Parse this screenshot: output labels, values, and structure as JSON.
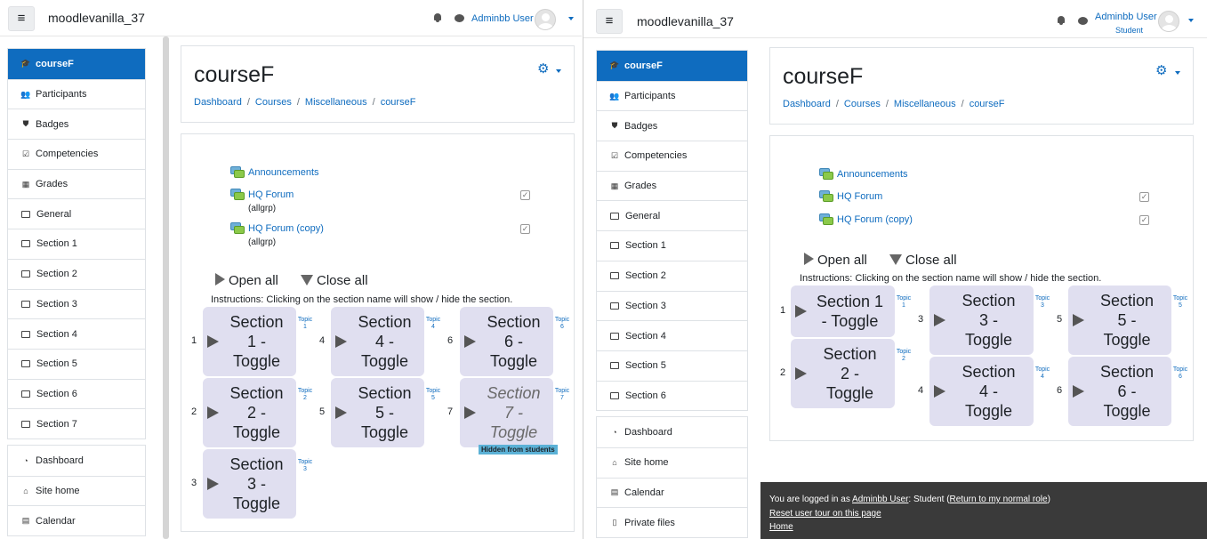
{
  "site_name": "moodlevanilla_37",
  "course_title": "courseF",
  "admin_window": {
    "user_name": "Adminbb User",
    "nav_main": [
      {
        "label": "courseF",
        "icon": "graduation-cap-icon",
        "active": true
      },
      {
        "label": "Participants",
        "icon": "users-icon"
      },
      {
        "label": "Badges",
        "icon": "shield-icon"
      },
      {
        "label": "Competencies",
        "icon": "check-square-icon"
      },
      {
        "label": "Grades",
        "icon": "table-icon"
      },
      {
        "label": "General",
        "icon": "folder-icon"
      },
      {
        "label": "Section 1",
        "icon": "folder-icon"
      },
      {
        "label": "Section 2",
        "icon": "folder-icon"
      },
      {
        "label": "Section 3",
        "icon": "folder-icon"
      },
      {
        "label": "Section 4",
        "icon": "folder-icon"
      },
      {
        "label": "Section 5",
        "icon": "folder-icon"
      },
      {
        "label": "Section 6",
        "icon": "folder-icon"
      },
      {
        "label": "Section 7",
        "icon": "folder-icon"
      }
    ],
    "nav_secondary": [
      {
        "label": "Dashboard",
        "icon": "tachometer-icon"
      },
      {
        "label": "Site home",
        "icon": "home-icon"
      },
      {
        "label": "Calendar",
        "icon": "calendar-icon"
      }
    ],
    "activities": [
      {
        "name": "Announcements",
        "note": "",
        "completion": false
      },
      {
        "name": "HQ Forum",
        "note": "(allgrp)",
        "completion": true
      },
      {
        "name": "HQ Forum (copy)",
        "note": "(allgrp)",
        "completion": true
      }
    ],
    "tiles": [
      {
        "number": "1",
        "lines": [
          "Section",
          "1 -",
          "Toggle"
        ],
        "topic": [
          "Topic",
          "1"
        ],
        "hidden": false
      },
      {
        "number": "2",
        "lines": [
          "Section",
          "2 -",
          "Toggle"
        ],
        "topic": [
          "Topic",
          "2"
        ],
        "hidden": false
      },
      {
        "number": "3",
        "lines": [
          "Section",
          "3 -",
          "Toggle"
        ],
        "topic": [
          "Topic",
          "3"
        ],
        "hidden": false
      },
      {
        "number": "4",
        "lines": [
          "Section",
          "4 -",
          "Toggle"
        ],
        "topic": [
          "Topic",
          "4"
        ],
        "hidden": false
      },
      {
        "number": "5",
        "lines": [
          "Section",
          "5 -",
          "Toggle"
        ],
        "topic": [
          "Topic",
          "5"
        ],
        "hidden": false
      },
      {
        "number": "6",
        "lines": [
          "Section",
          "6 -",
          "Toggle"
        ],
        "topic": [
          "Topic",
          "6"
        ],
        "hidden": false
      },
      {
        "number": "7",
        "lines": [
          "Section",
          "7 -",
          "Toggle"
        ],
        "topic": [
          "Topic",
          "7"
        ],
        "hidden": true
      }
    ]
  },
  "student_window": {
    "user_name": "Adminbb User",
    "role": "Student",
    "nav_main": [
      {
        "label": "courseF",
        "icon": "graduation-cap-icon",
        "active": true
      },
      {
        "label": "Participants",
        "icon": "users-icon"
      },
      {
        "label": "Badges",
        "icon": "shield-icon"
      },
      {
        "label": "Competencies",
        "icon": "check-square-icon"
      },
      {
        "label": "Grades",
        "icon": "table-icon"
      },
      {
        "label": "General",
        "icon": "folder-icon"
      },
      {
        "label": "Section 1",
        "icon": "folder-icon"
      },
      {
        "label": "Section 2",
        "icon": "folder-icon"
      },
      {
        "label": "Section 3",
        "icon": "folder-icon"
      },
      {
        "label": "Section 4",
        "icon": "folder-icon"
      },
      {
        "label": "Section 5",
        "icon": "folder-icon"
      },
      {
        "label": "Section 6",
        "icon": "folder-icon"
      }
    ],
    "nav_secondary": [
      {
        "label": "Dashboard",
        "icon": "tachometer-icon"
      },
      {
        "label": "Site home",
        "icon": "home-icon"
      },
      {
        "label": "Calendar",
        "icon": "calendar-icon"
      },
      {
        "label": "Private files",
        "icon": "file-icon"
      }
    ],
    "activities": [
      {
        "name": "Announcements",
        "note": "",
        "completion": false
      },
      {
        "name": "HQ Forum",
        "note": "",
        "completion": true
      },
      {
        "name": "HQ Forum (copy)",
        "note": "",
        "completion": true
      }
    ],
    "tiles": [
      {
        "number": "1",
        "lines": [
          "Section 1",
          "- Toggle"
        ],
        "topic": [
          "Topic",
          "1"
        ],
        "hidden": false
      },
      {
        "number": "2",
        "lines": [
          "Section",
          "2 -",
          "Toggle"
        ],
        "topic": [
          "Topic",
          "2"
        ],
        "hidden": false
      },
      {
        "number": "3",
        "lines": [
          "Section",
          "3 -",
          "Toggle"
        ],
        "topic": [
          "Topic",
          "3"
        ],
        "hidden": false
      },
      {
        "number": "4",
        "lines": [
          "Section",
          "4 -",
          "Toggle"
        ],
        "topic": [
          "Topic",
          "4"
        ],
        "hidden": false
      },
      {
        "number": "5",
        "lines": [
          "Section",
          "5 -",
          "Toggle"
        ],
        "topic": [
          "Topic",
          "5"
        ],
        "hidden": false
      },
      {
        "number": "6",
        "lines": [
          "Section",
          "6 -",
          "Toggle"
        ],
        "topic": [
          "Topic",
          "6"
        ],
        "hidden": false
      }
    ],
    "footer": {
      "logged_in_prefix": "You are logged in as ",
      "logged_in_user": "Adminbb User",
      "logged_in_role": ": Student (",
      "return_link": "Return to my normal role",
      "logged_in_suffix": ")",
      "reset_tour": "Reset user tour on this page",
      "home": "Home"
    }
  },
  "breadcrumb": [
    "Dashboard",
    "Courses",
    "Miscellaneous",
    "courseF"
  ],
  "open_all": "Open all",
  "close_all": "Close all",
  "instructions": "Instructions: Clicking on the section name will show / hide the section.",
  "hidden_badge": "Hidden from students",
  "colors": {
    "accent": "#0f6cbf",
    "tile": "#e0dff0",
    "badge": "#5bb1d6"
  }
}
